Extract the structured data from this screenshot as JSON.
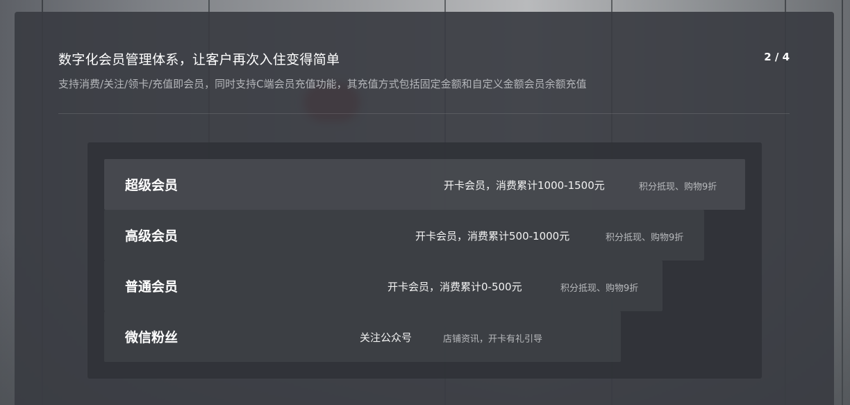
{
  "header": {
    "title": "数字化会员管理体系，让客户再次入住变得简单",
    "subtitle": "支持消费/关注/领卡/充值即会员，同时支持C端会员充值功能，其充值方式包括固定金额和自定义金额会员余额充值",
    "page_indicator": "2 / 4"
  },
  "tiers": [
    {
      "name": "超级会员",
      "condition": "开卡会员，消费累计1000-1500元",
      "benefit": "积分抵现、购物9折"
    },
    {
      "name": "高级会员",
      "condition": "开卡会员，消费累计500-1000元",
      "benefit": "积分抵现、购物9折"
    },
    {
      "name": "普通会员",
      "condition": "开卡会员，消费累计0-500元",
      "benefit": "积分抵现、购物9折"
    },
    {
      "name": "微信粉丝",
      "condition": "关注公众号",
      "benefit": "店铺资讯，开卡有礼引导"
    }
  ]
}
